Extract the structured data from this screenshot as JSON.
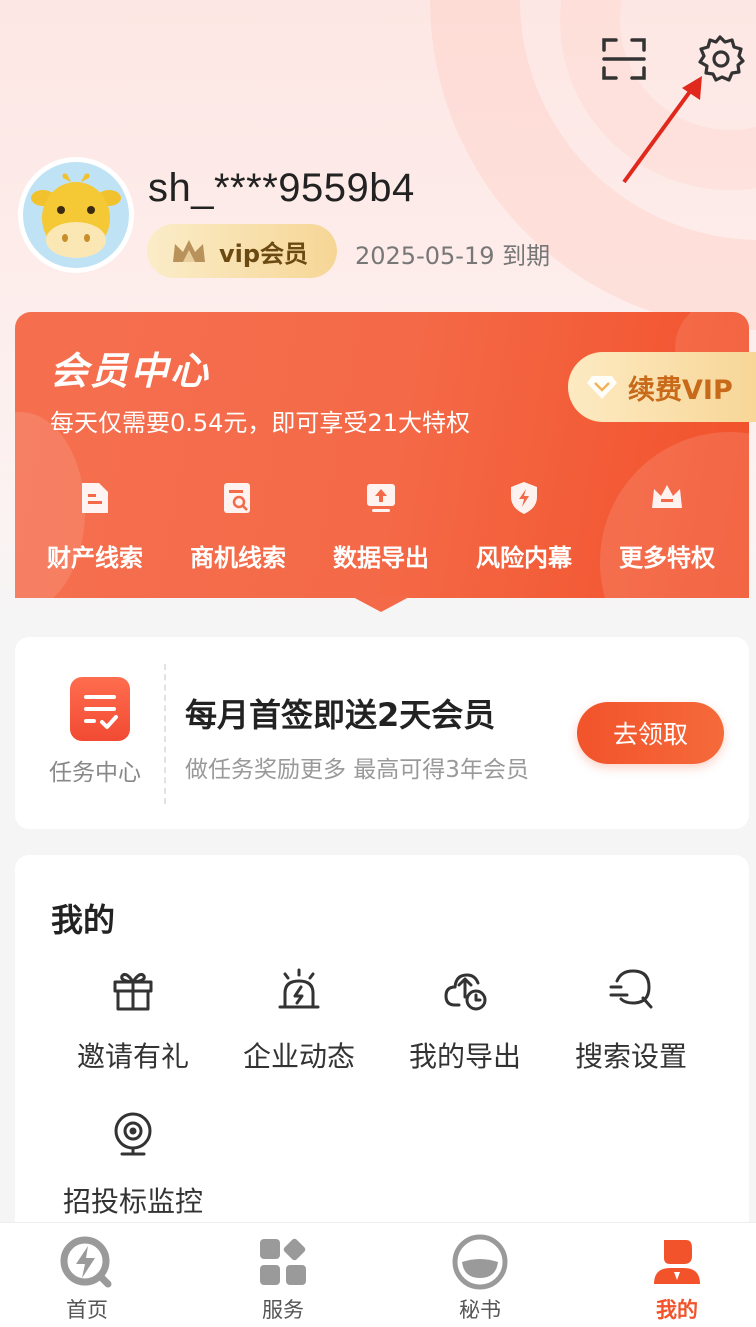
{
  "header": {
    "scan_icon": "scan-icon",
    "settings_icon": "gear-icon"
  },
  "user": {
    "username": "sh_****9559b4",
    "vip_label": "vip会员",
    "expire_text": "2025-05-19 到期"
  },
  "member_center": {
    "title": "会员中心",
    "subtitle": "每天仅需要0.54元，即可享受21大特权",
    "renew_label": "续费VIP",
    "privileges": [
      {
        "label": "财产线索",
        "icon": "document-icon"
      },
      {
        "label": "商机线索",
        "icon": "search-document-icon"
      },
      {
        "label": "数据导出",
        "icon": "upload-icon"
      },
      {
        "label": "风险内幕",
        "icon": "shield-icon"
      },
      {
        "label": "更多特权",
        "icon": "crown-icon"
      }
    ]
  },
  "task": {
    "center_label": "任务中心",
    "title": "每月首签即送2天会员",
    "subtitle": "做任务奖励更多 最高可得3年会员",
    "button_label": "去领取"
  },
  "mine": {
    "title": "我的",
    "items": [
      {
        "label": "邀请有礼",
        "icon": "gift-icon"
      },
      {
        "label": "企业动态",
        "icon": "alarm-icon"
      },
      {
        "label": "我的导出",
        "icon": "export-icon"
      },
      {
        "label": "搜索设置",
        "icon": "search-settings-icon"
      },
      {
        "label": "招投标监控",
        "icon": "camera-icon"
      }
    ]
  },
  "bottom_nav": {
    "items": [
      {
        "label": "首页",
        "icon": "home-icon",
        "active": false
      },
      {
        "label": "服务",
        "icon": "grid-icon",
        "active": false
      },
      {
        "label": "秘书",
        "icon": "secretary-icon",
        "active": false
      },
      {
        "label": "我的",
        "icon": "profile-icon",
        "active": true
      }
    ]
  },
  "colors": {
    "accent": "#f2532b",
    "gold": "#f7d594",
    "card_gradient_start": "#f56f4f"
  }
}
